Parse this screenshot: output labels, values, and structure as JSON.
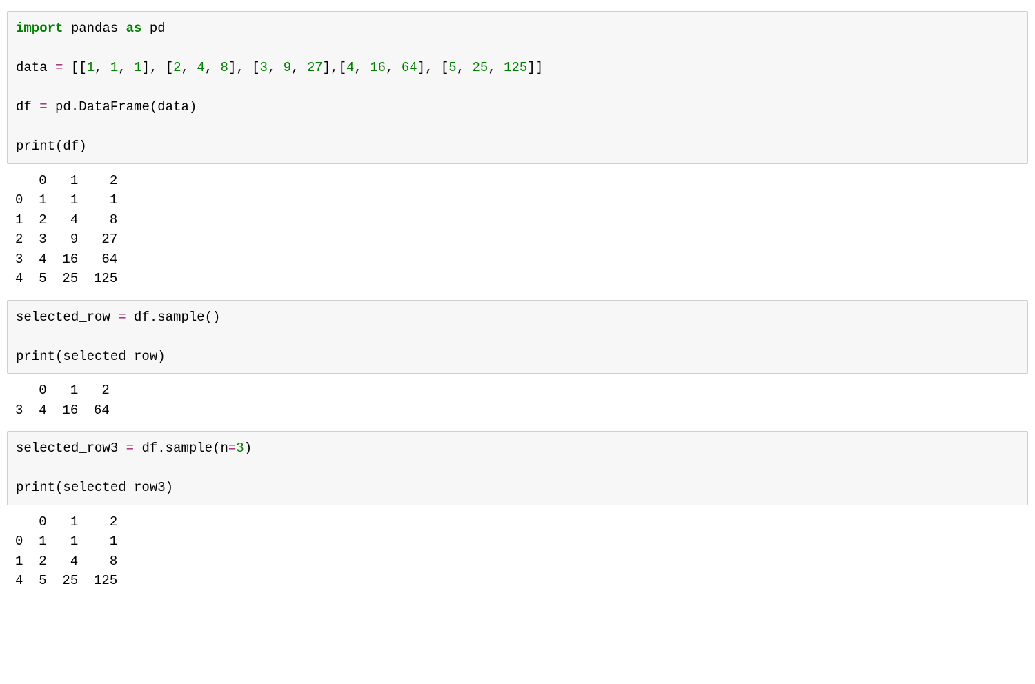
{
  "cells": [
    {
      "type": "code",
      "code_html": "<span class='kw'>import</span> pandas <span class='kw'>as</span> pd\n\ndata <span class='op'>=</span> [[<span class='num'>1</span>, <span class='num'>1</span>, <span class='num'>1</span>], [<span class='num'>2</span>, <span class='num'>4</span>, <span class='num'>8</span>], [<span class='num'>3</span>, <span class='num'>9</span>, <span class='num'>27</span>],[<span class='num'>4</span>, <span class='num'>16</span>, <span class='num'>64</span>], [<span class='num'>5</span>, <span class='num'>25</span>, <span class='num'>125</span>]]\n\ndf <span class='op'>=</span> pd.DataFrame(data)\n\n<span class='fn'>print</span>(df)",
      "output": "   0   1    2\n0  1   1    1\n1  2   4    8\n2  3   9   27\n3  4  16   64\n4  5  25  125"
    },
    {
      "type": "code",
      "code_html": "selected_row <span class='op'>=</span> df.sample()\n\n<span class='fn'>print</span>(selected_row)",
      "output": "   0   1   2\n3  4  16  64"
    },
    {
      "type": "code",
      "code_html": "selected_row3 <span class='op'>=</span> df.sample(n<span class='op'>=</span><span class='num'>3</span>)\n\n<span class='fn'>print</span>(selected_row3)",
      "output": "   0   1    2\n0  1   1    1\n1  2   4    8\n4  5  25  125"
    }
  ]
}
